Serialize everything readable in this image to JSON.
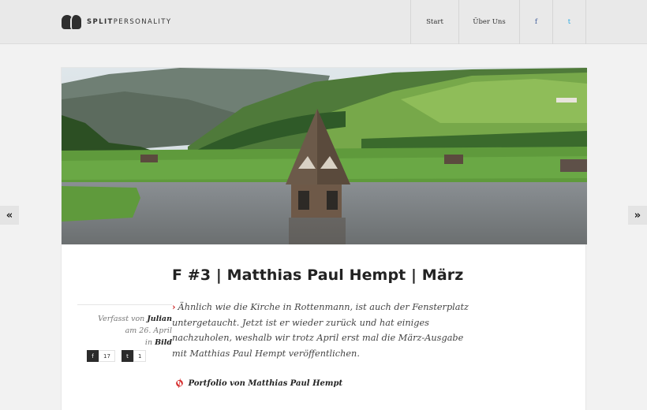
{
  "header": {
    "logo_bold": "SPLIT",
    "logo_light": "PERSONALITY",
    "nav": {
      "start": "Start",
      "about": "Über Uns",
      "facebook": "f",
      "twitter": "t"
    }
  },
  "pager": {
    "prev": "«",
    "next": "»"
  },
  "post": {
    "title": "F #3 | Matthias Paul Hempt | März",
    "meta": {
      "written_by_prefix": "Verfasst von",
      "author": "Julian",
      "date": "am 26. April",
      "in_prefix": "in",
      "category": "Bild"
    },
    "share": {
      "facebook_icon": "f",
      "facebook_count": "17",
      "twitter_icon": "t",
      "twitter_count": "1"
    },
    "body_mark": "›",
    "body": "Ähnlich wie die Kirche in Rottenmann, ist auch der Fensterplatz untergetaucht. Jetzt ist er wieder zurück und hat einiges nachzuholen, weshalb wir trotz April erst mal die März-Ausgabe mit Matthias Paul Hempt veröffentlichen.",
    "portfolio_link": "Portfolio von Matthias Paul Hempt"
  },
  "colors": {
    "accent": "#cc2222",
    "facebook": "#3b5998",
    "twitter": "#29a9e1"
  }
}
